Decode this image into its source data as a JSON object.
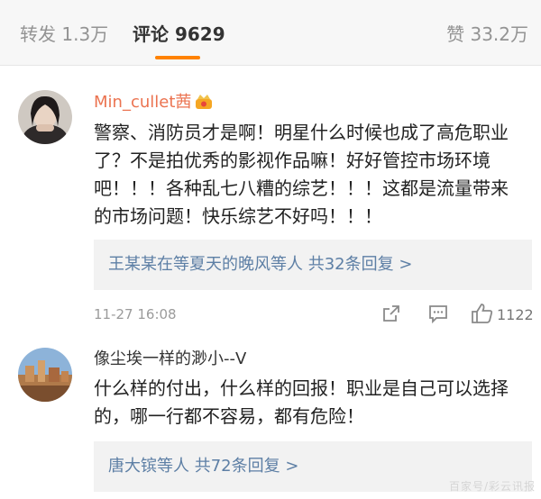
{
  "tabs": {
    "repost": "转发 1.3万",
    "comments": "评论 9629",
    "likes": "赞 33.2万"
  },
  "comments": [
    {
      "username": "Min_cullet茜",
      "text": "警察、消防员才是啊！明星什么时候也成了高危职业了？不是拍优秀的影视作品嘛！好好管控市场环境吧！！！各种乱七八糟的综艺！！！这都是流量带来的市场问题！快乐综艺不好吗！！！",
      "reply_summary": "王某某在等夏天的晚风等人 共32条回复 >",
      "timestamp": "11-27 16:08",
      "like_count": "1122"
    },
    {
      "username": "像尘埃一样的渺小--V",
      "text": "什么样的付出，什么样的回报！职业是自己可以选择的，哪一行都不容易，都有危险！",
      "reply_summary": "唐大镔等人 共72条回复 >"
    }
  ],
  "watermark": "百家号/彩云讯报",
  "colors": {
    "accent": "#ff8200",
    "username_vip": "#eb7350",
    "link": "#5d7fa5"
  },
  "icons": [
    "vip-crown-icon",
    "share-icon",
    "comment-icon",
    "like-icon"
  ]
}
